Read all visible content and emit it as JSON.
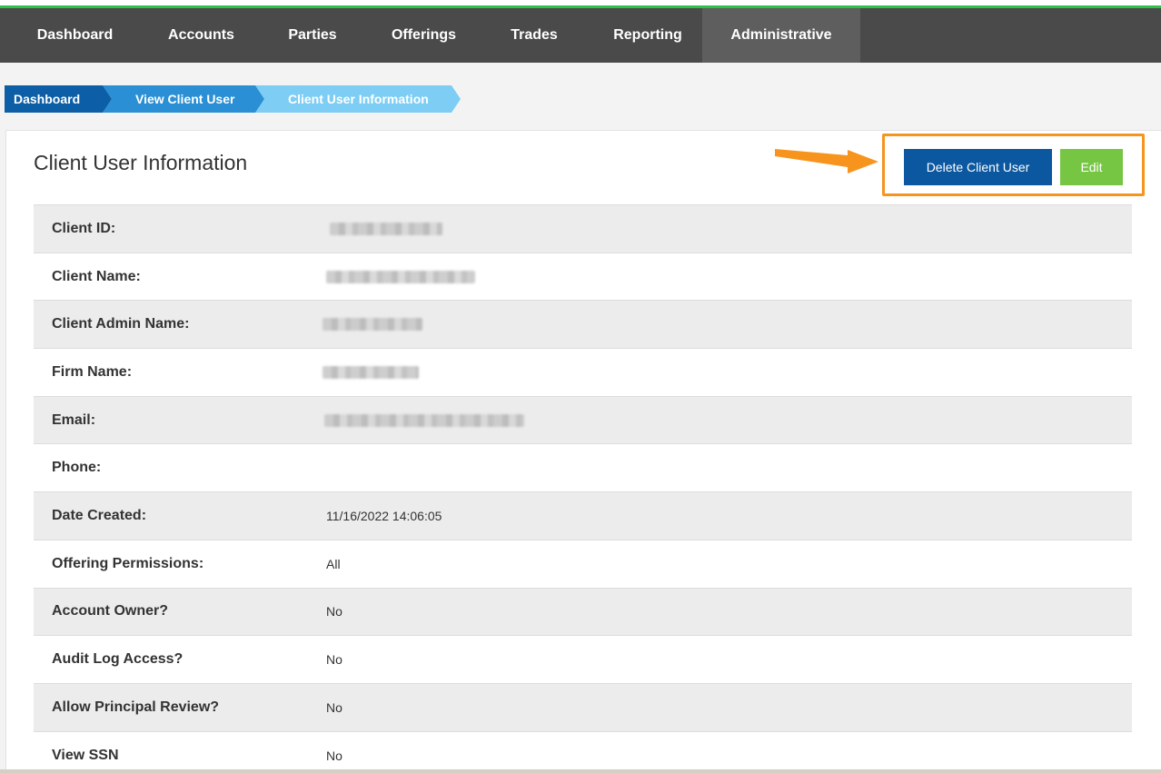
{
  "nav": {
    "items": [
      {
        "label": "Dashboard",
        "active": false
      },
      {
        "label": "Accounts",
        "active": false
      },
      {
        "label": "Parties",
        "active": false
      },
      {
        "label": "Offerings",
        "active": false
      },
      {
        "label": "Trades",
        "active": false
      },
      {
        "label": "Reporting",
        "active": false
      },
      {
        "label": "Administrative",
        "active": true
      }
    ]
  },
  "breadcrumb": {
    "items": [
      "Dashboard",
      "View Client User",
      "Client User Information"
    ]
  },
  "page": {
    "title": "Client User Information",
    "delete_label": "Delete Client User",
    "edit_label": "Edit"
  },
  "details": {
    "rows": [
      {
        "label": "Client ID:",
        "value": "",
        "redacted": true
      },
      {
        "label": "Client Name:",
        "value": "",
        "redacted": true
      },
      {
        "label": "Client Admin Name:",
        "value": "",
        "redacted": true
      },
      {
        "label": "Firm Name:",
        "value": "",
        "redacted": true
      },
      {
        "label": "Email:",
        "value": "",
        "redacted": true
      },
      {
        "label": "Phone:",
        "value": "",
        "redacted": false
      },
      {
        "label": "Date Created:",
        "value": "11/16/2022 14:06:05",
        "redacted": false
      },
      {
        "label": "Offering Permissions:",
        "value": "All",
        "redacted": false
      },
      {
        "label": "Account Owner?",
        "value": "No",
        "redacted": false
      },
      {
        "label": "Audit Log Access?",
        "value": "No",
        "redacted": false
      },
      {
        "label": "Allow Principal Review?",
        "value": "No",
        "redacted": false
      },
      {
        "label": "View SSN",
        "value": "No",
        "redacted": false
      }
    ]
  },
  "colors": {
    "nav_bg": "#4a4a4a",
    "nav_active_bg": "#5e5e5e",
    "accent_green": "#2fc24a",
    "delete_button": "#0c58a0",
    "edit_button": "#76c644",
    "annotation": "#f7941d"
  }
}
